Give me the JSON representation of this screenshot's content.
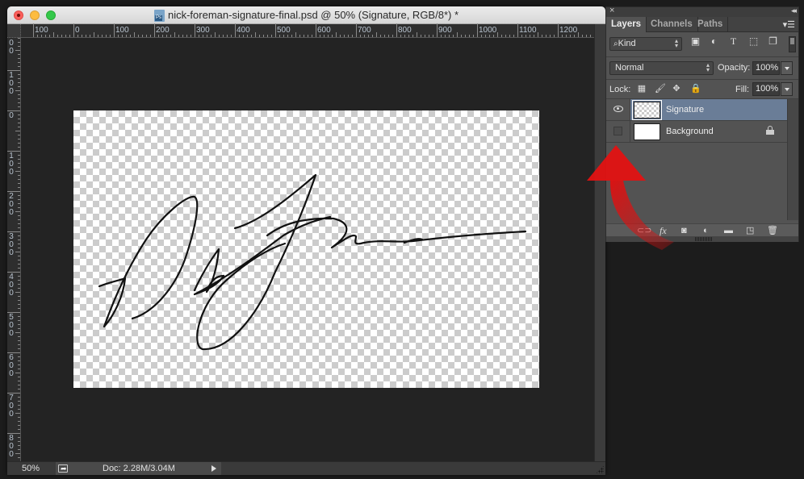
{
  "document": {
    "title": "nick-foreman-signature-final.psd @ 50% (Signature, RGB/8*) *",
    "zoom": "50%",
    "doc_size": "Doc: 2.28M/3.04M",
    "ruler_top_labels": [
      "100",
      "0",
      "100",
      "200",
      "300",
      "400",
      "500",
      "600",
      "700",
      "800",
      "900",
      "1000",
      "1100",
      "1200"
    ],
    "ruler_left_labels": [
      "00",
      "100",
      "0",
      "100",
      "200",
      "300",
      "400",
      "500",
      "600",
      "700",
      "800"
    ]
  },
  "panel": {
    "tabs": [
      {
        "label": "Layers",
        "active": true
      },
      {
        "label": "Channels",
        "active": false
      },
      {
        "label": "Paths",
        "active": false
      }
    ],
    "filter": {
      "kind_label": "Kind",
      "icons": [
        "pixel-filter-icon",
        "adjustment-filter-icon",
        "type-filter-icon",
        "shape-filter-icon",
        "smart-object-filter-icon"
      ]
    },
    "blend_mode": "Normal",
    "opacity_label": "Opacity:",
    "opacity_value": "100%",
    "lock_label": "Lock:",
    "fill_label": "Fill:",
    "fill_value": "100%",
    "layers": [
      {
        "name": "Signature",
        "visible": true,
        "selected": true,
        "locked": false
      },
      {
        "name": "Background",
        "visible": false,
        "selected": false,
        "locked": true
      }
    ],
    "footer_icons": [
      "link-layers-icon",
      "fx-icon",
      "add-mask-icon",
      "adjustment-layer-icon",
      "new-group-icon",
      "new-layer-icon",
      "delete-layer-icon"
    ]
  },
  "annotation": {
    "arrow_color": "#e01010"
  }
}
